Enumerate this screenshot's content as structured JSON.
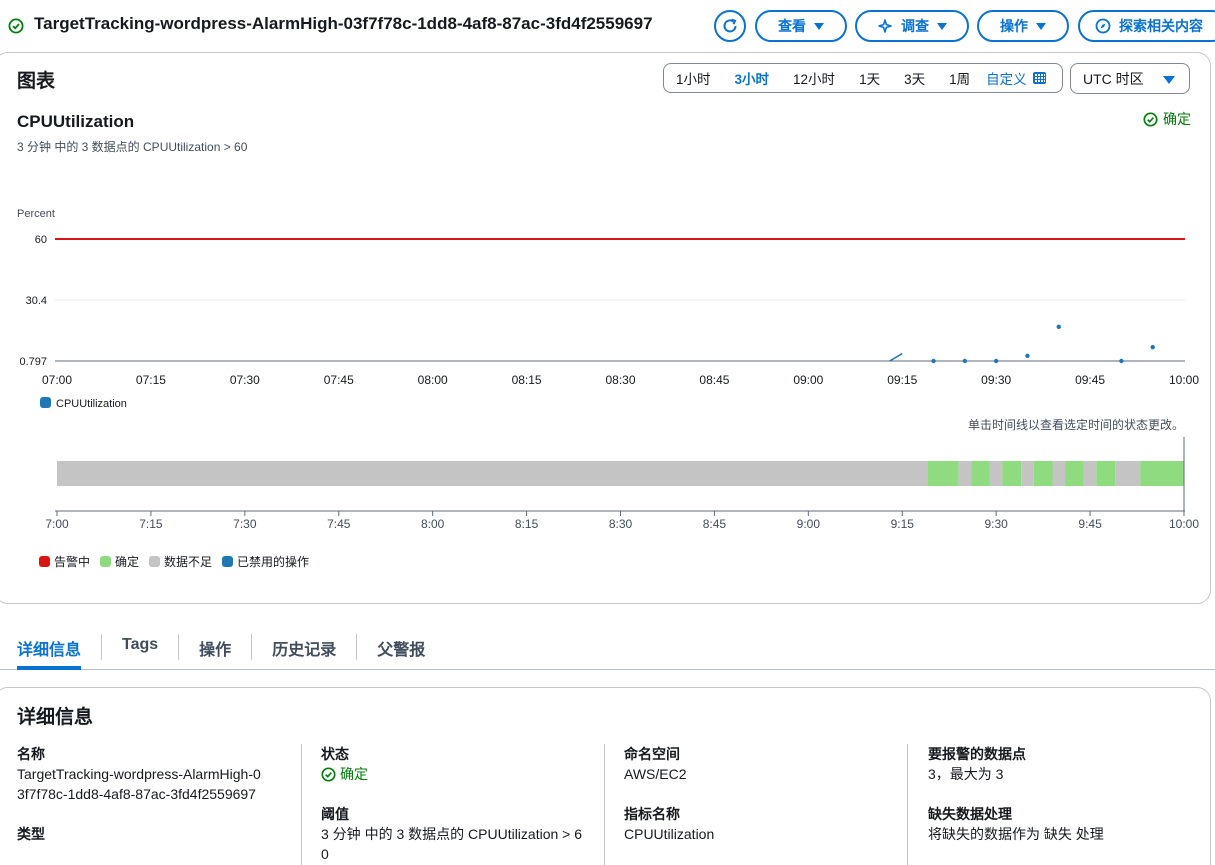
{
  "header": {
    "title": "TargetTracking-wordpress-AlarmHigh-03f7f78c-1dd8-4af8-87ac-3fd4f2559697",
    "buttons": {
      "view": "查看",
      "investigate": "调查",
      "actions": "操作",
      "explore": "探索相关内容"
    }
  },
  "graph_panel": {
    "title": "图表",
    "time_ranges": [
      "1小时",
      "3小时",
      "12小时",
      "1天",
      "3天",
      "1周"
    ],
    "active_range": "3小时",
    "custom_label": "自定义",
    "timezone": "UTC 时区",
    "chart_title": "CPUUtilization",
    "chart_description": "3 分钟 中的 3 数据点的 CPUUtilization > 60",
    "state_label": "确定",
    "timeline_hint": "单击时间线以查看选定时间的状态更改。"
  },
  "chart_data": [
    {
      "type": "scatter",
      "title": "CPUUtilization",
      "ylabel": "Percent",
      "y_ticks": [
        "60",
        "30.4",
        "0.797"
      ],
      "x_ticks": [
        "07:00",
        "07:15",
        "07:30",
        "07:45",
        "08:00",
        "08:15",
        "08:30",
        "08:45",
        "09:00",
        "09:15",
        "09:30",
        "09:45",
        "10:00"
      ],
      "xlim": [
        "07:00",
        "10:00"
      ],
      "ylim": [
        0.797,
        60
      ],
      "threshold": 60,
      "series": [
        {
          "name": "CPUUtilization",
          "color": "#1f77b4",
          "segment": [
            [
              "09:13",
              0.797
            ],
            [
              "09:15",
              4.4
            ]
          ],
          "points": [
            [
              "09:20",
              0.797
            ],
            [
              "09:25",
              0.797
            ],
            [
              "09:30",
              0.797
            ],
            [
              "09:35",
              3.3
            ],
            [
              "09:40",
              17.4
            ],
            [
              "09:50",
              0.797
            ],
            [
              "09:55",
              7.5
            ]
          ]
        }
      ]
    },
    {
      "type": "timeline",
      "x_ticks": [
        "7:00",
        "7:15",
        "7:30",
        "7:45",
        "8:00",
        "8:15",
        "8:30",
        "8:45",
        "9:00",
        "9:15",
        "9:30",
        "9:45",
        "10:00"
      ],
      "xlim": [
        "07:00",
        "10:00"
      ],
      "segments": [
        {
          "start": "07:00",
          "end": "09:19",
          "state": "insufficient"
        },
        {
          "start": "09:19",
          "end": "09:24",
          "state": "ok"
        },
        {
          "start": "09:24",
          "end": "09:26",
          "state": "insufficient"
        },
        {
          "start": "09:26",
          "end": "09:29",
          "state": "ok"
        },
        {
          "start": "09:29",
          "end": "09:31",
          "state": "insufficient"
        },
        {
          "start": "09:31",
          "end": "09:34",
          "state": "ok"
        },
        {
          "start": "09:34",
          "end": "09:36",
          "state": "insufficient"
        },
        {
          "start": "09:36",
          "end": "09:39",
          "state": "ok"
        },
        {
          "start": "09:39",
          "end": "09:41",
          "state": "insufficient"
        },
        {
          "start": "09:41",
          "end": "09:44",
          "state": "ok"
        },
        {
          "start": "09:44",
          "end": "09:46",
          "state": "insufficient"
        },
        {
          "start": "09:46",
          "end": "09:49",
          "state": "ok"
        },
        {
          "start": "09:49",
          "end": "09:53",
          "state": "insufficient"
        },
        {
          "start": "09:53",
          "end": "10:00",
          "state": "ok"
        }
      ],
      "legend": [
        {
          "state": "alarm",
          "label": "告警中",
          "color": "#d91515"
        },
        {
          "state": "ok",
          "label": "确定",
          "color": "#8fdb7f"
        },
        {
          "state": "insufficient",
          "label": "数据不足",
          "color": "#c4c4c4"
        },
        {
          "state": "disabled",
          "label": "已禁用的操作",
          "color": "#1f77b4"
        }
      ]
    }
  ],
  "tabs": [
    "详细信息",
    "Tags",
    "操作",
    "历史记录",
    "父警报"
  ],
  "active_tab": "详细信息",
  "details": {
    "title": "详细信息",
    "name_label": "名称",
    "name_value": "TargetTracking-wordpress-AlarmHigh-03f7f78c-1dd8-4af8-87ac-3fd4f2559697",
    "type_label": "类型",
    "state_label": "状态",
    "state_value": "确定",
    "threshold_label": "阈值",
    "threshold_value": "3 分钟 中的 3 数据点的 CPUUtilization > 60",
    "namespace_label": "命名空间",
    "namespace_value": "AWS/EC2",
    "metric_label": "指标名称",
    "metric_value": "CPUUtilization",
    "datapoints_label": "要报警的数据点",
    "datapoints_value": "3，最大为 3",
    "missing_label": "缺失数据处理",
    "missing_value": "将缺失的数据作为 缺失 处理"
  },
  "colors": {
    "accent": "#0972d3",
    "ok": "#037f0c",
    "threshold": "#d91515",
    "series": "#1f77b4"
  }
}
